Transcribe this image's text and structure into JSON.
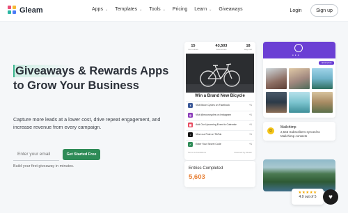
{
  "brand": {
    "name": "Gleam"
  },
  "nav": {
    "items": [
      {
        "label": "Apps",
        "dropdown": true
      },
      {
        "label": "Templates",
        "dropdown": true
      },
      {
        "label": "Tools",
        "dropdown": true
      },
      {
        "label": "Pricing",
        "dropdown": false
      },
      {
        "label": "Learn",
        "dropdown": true
      },
      {
        "label": "Giveaways",
        "dropdown": false
      }
    ],
    "login": "Login",
    "signup": "Sign up"
  },
  "hero": {
    "title_highlight": "Giveaways",
    "title_rest": " & Rewards Apps to Grow Your Business",
    "subtitle": "Capture more leads at a lower cost, drive repeat engagement, and increase revenue from every campaign.",
    "email_placeholder": "Enter your email",
    "cta": "Get Started Free",
    "hint": "Build your first giveaway in minutes."
  },
  "giveaway": {
    "stats": [
      {
        "value": "15",
        "label": "Your entries"
      },
      {
        "value": "43,503",
        "label": "Total entries"
      },
      {
        "value": "18",
        "label": "Days left"
      }
    ],
    "title": "Win a Brand New Bicycle",
    "tasks": [
      {
        "label": "Visit Moon Cycles on Facebook",
        "points": "+1",
        "color": "#3b5998",
        "icon": "facebook-icon",
        "glyph": "f"
      },
      {
        "label": "Visit @mooncycles on Instagram",
        "points": "+1",
        "color": "#8a3ab9",
        "icon": "instagram-icon",
        "glyph": "◎"
      },
      {
        "label": "Add Our Upcoming Event to Calendar",
        "points": "+1",
        "color": "#e84a5f",
        "icon": "calendar-icon",
        "glyph": "▦"
      },
      {
        "label": "View our Post on TikTok",
        "points": "+1",
        "color": "#111111",
        "icon": "tiktok-icon",
        "glyph": "♪"
      },
      {
        "label": "Enter Your Secret Code",
        "points": "+1",
        "color": "#2e8b57",
        "icon": "key-icon",
        "glyph": "✓"
      }
    ],
    "footer_left": "Terms & Conditions",
    "footer_right": "Powered by Gleam"
  },
  "entries": {
    "label": "Entries Completed",
    "value": "5,603"
  },
  "gallery": {
    "pill": "Upload photo",
    "accent": "#6b3fd4"
  },
  "mailchimp": {
    "title": "Mailchimp",
    "subtitle": "2,543 Subscribers synced to Mailchimp contacts"
  },
  "rating": {
    "stars": "★★★★★",
    "text": "4.9 out of 5"
  },
  "colors": {
    "primary_green": "#2e8b57",
    "orange": "#e8833a",
    "purple": "#6b3fd4"
  }
}
